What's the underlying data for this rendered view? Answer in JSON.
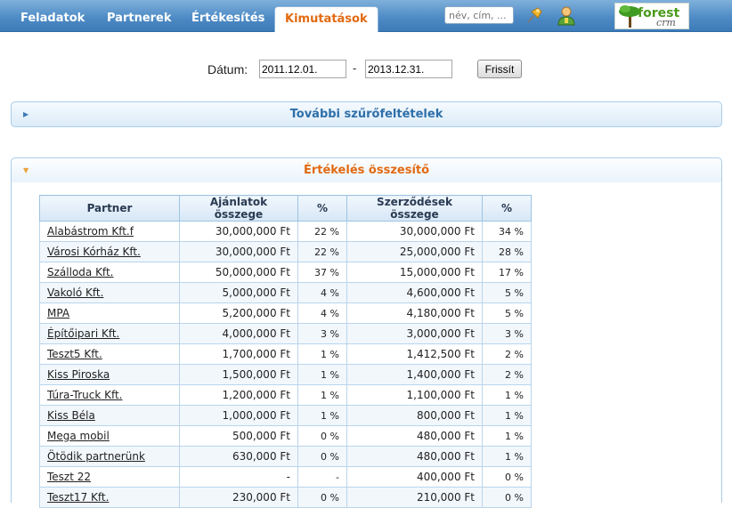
{
  "nav": {
    "tabs": [
      {
        "label": "Feladatok"
      },
      {
        "label": "Partnerek"
      },
      {
        "label": "Értékesítés"
      },
      {
        "label": "Kimutatások"
      }
    ],
    "active_tab": "Kimutatások",
    "search_placeholder": "név, cím, ...",
    "icons": [
      "pin-icon",
      "user-icon"
    ]
  },
  "logo": {
    "text": "forest",
    "subtext": "crm"
  },
  "filter": {
    "date_label": "Dátum:",
    "date_from": "2011.12.01.",
    "date_to": "2013.12.31.",
    "separator": "-",
    "refresh_label": "Frissít"
  },
  "panels": {
    "more_filters": "További szűrőfeltételek",
    "summary": "Értékelés összesítő"
  },
  "table": {
    "headers": [
      "Partner",
      "Ajánlatok összege",
      "%",
      "Szerződések összege",
      "%"
    ],
    "rows": [
      {
        "partner": "Alabástrom Kft.f",
        "offers": "30,000,000 Ft",
        "offers_pct": "22 %",
        "contracts": "30,000,000 Ft",
        "contracts_pct": "34 %"
      },
      {
        "partner": "Városi Kórház Kft.",
        "offers": "30,000,000 Ft",
        "offers_pct": "22 %",
        "contracts": "25,000,000 Ft",
        "contracts_pct": "28 %"
      },
      {
        "partner": "Szálloda Kft.",
        "offers": "50,000,000 Ft",
        "offers_pct": "37 %",
        "contracts": "15,000,000 Ft",
        "contracts_pct": "17 %"
      },
      {
        "partner": "Vakoló Kft.",
        "offers": "5,000,000 Ft",
        "offers_pct": "4 %",
        "contracts": "4,600,000 Ft",
        "contracts_pct": "5 %"
      },
      {
        "partner": "MPA",
        "offers": "5,200,000 Ft",
        "offers_pct": "4 %",
        "contracts": "4,180,000 Ft",
        "contracts_pct": "5 %"
      },
      {
        "partner": "Építőipari Kft.",
        "offers": "4,000,000 Ft",
        "offers_pct": "3 %",
        "contracts": "3,000,000 Ft",
        "contracts_pct": "3 %"
      },
      {
        "partner": "Teszt5 Kft.",
        "offers": "1,700,000 Ft",
        "offers_pct": "1 %",
        "contracts": "1,412,500 Ft",
        "contracts_pct": "2 %"
      },
      {
        "partner": "Kiss Piroska",
        "offers": "1,500,000 Ft",
        "offers_pct": "1 %",
        "contracts": "1,400,000 Ft",
        "contracts_pct": "2 %"
      },
      {
        "partner": "Túra-Truck Kft.",
        "offers": "1,200,000 Ft",
        "offers_pct": "1 %",
        "contracts": "1,100,000 Ft",
        "contracts_pct": "1 %"
      },
      {
        "partner": "Kiss Béla",
        "offers": "1,000,000 Ft",
        "offers_pct": "1 %",
        "contracts": "800,000 Ft",
        "contracts_pct": "1 %"
      },
      {
        "partner": "Mega mobil",
        "offers": "500,000 Ft",
        "offers_pct": "0 %",
        "contracts": "480,000 Ft",
        "contracts_pct": "1 %"
      },
      {
        "partner": "Ötödik partnerünk",
        "offers": "630,000 Ft",
        "offers_pct": "0 %",
        "contracts": "480,000 Ft",
        "contracts_pct": "1 %"
      },
      {
        "partner": "Teszt 22",
        "offers": "-",
        "offers_pct": "-",
        "contracts": "400,000 Ft",
        "contracts_pct": "0 %"
      },
      {
        "partner": "Teszt17 Kft.",
        "offers": "230,000 Ft",
        "offers_pct": "0 %",
        "contracts": "210,000 Ft",
        "contracts_pct": "0 %"
      }
    ]
  },
  "colors": {
    "nav_bar": "#4f8cc6",
    "active_tab_text": "#e26a12",
    "filters_header_text": "#2e6fa9",
    "summary_header_text": "#e26a12",
    "table_header_bg": "#d6e7f6",
    "row_stripe": "#f2f7fc"
  }
}
